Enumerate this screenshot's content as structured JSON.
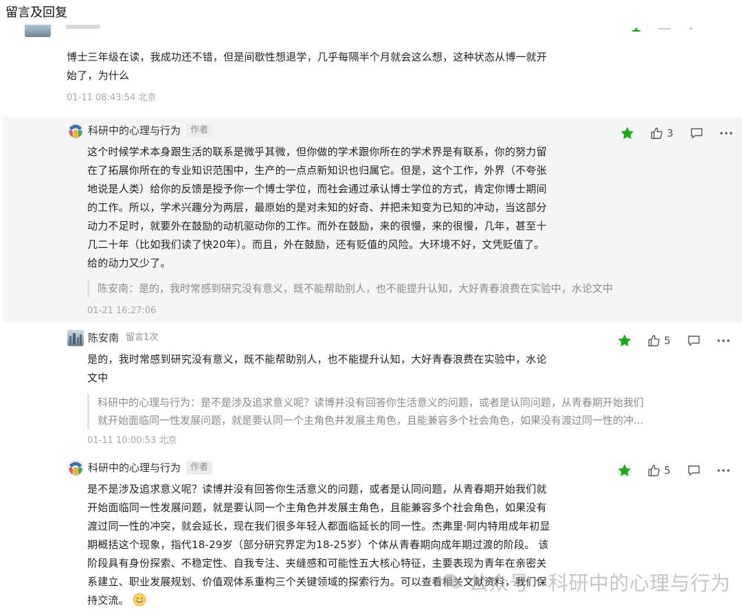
{
  "section_title": "留言及回复",
  "colors": {
    "star_green": "#1aad19",
    "background_highlight": "#f5f5f5",
    "meta_gray": "#a6a6a6",
    "quote_gray": "#8a8a8a"
  },
  "comments": [
    {
      "author": "",
      "content_lines": [
        "博士三年级在读，我成功还不错，但是间歇性想退学，几乎每隔半个月就会这么想，这种状态从博一就开",
        "始了，为什么"
      ],
      "meta": "01-11 08:43:54 北京"
    },
    {
      "author": "科研中的心理与行为",
      "tag": "作者",
      "likes": "3",
      "content_lines": [
        "这个时候学术本身跟生活的联系是微乎其微，但你做的学术跟你所在的学术界是有联系，你的努力留",
        "在了拓展你所在的专业知识范围中，生产的一点点新知识也归属它。但是，这个工作，外界（不夸张",
        "地说是人类）给你的反馈是授予你一个博士学位，而社会通过承认博士学位的方式，肯定你博士期间",
        "的工作。所以，学术兴趣分为两层，最原始的是对未知的好奇、并把未知变为已知的冲动，当这部分",
        "动力不足时，就要外在鼓励的动机驱动你的工作。而外在鼓励，来的很慢，来的很慢，几年，甚至十",
        "几二十年（比如我们读了快20年）。而且，外在鼓励，还有贬值的风险。大环境不好，文凭贬值了。",
        "给的动力又少了。"
      ],
      "quote_lines": [
        "陈安南：是的，我时常感到研究没有意义，既不能帮助别人，也不能提升认知，大好青春浪费在实验中，水论文中"
      ],
      "meta": "01-21 16:27:06"
    },
    {
      "author": "陈安南",
      "tag": "留言1次",
      "likes": "5",
      "content_lines": [
        "是的，我时常感到研究没有意义，既不能帮助别人，也不能提升认知，大好青春浪费在实验中，水论",
        "文中"
      ],
      "quote_lines": [
        "科研中的心理与行为：是不是涉及追求意义呢？读博并没有回答你生活意义的问题，或者是认同问题，从青春期开始我们",
        "就开始面临同一性发展问题，就是要认同一个主角色并发展主角色，且能兼容多个社会角色，如果没有渡过同一性的冲..."
      ],
      "meta": "01-11 10:00:53 北京"
    },
    {
      "author": "科研中的心理与行为",
      "tag": "作者",
      "likes": "5",
      "content_lines": [
        "是不是涉及追求意义呢？读博并没有回答你生活意义的问题，或者是认同问题，从青春期开始我们就",
        "开始面临同一性发展问题，就是要认同一个主角色并发展主角色，且能兼容多个社会角色，如果没有",
        "渡过同一性的冲突，就会延长，现在我们很多年轻人都面临延长的同一性。杰弗里·阿内特用成年初显",
        "期概括这个现象，指代18-29岁（部分研究界定为18-25岁）个体从青春期向成年期过渡的阶段。 该",
        "阶段具有身份探索、不稳定性、自我专注、夹缝感和可能性五大核心特征，主要表现为青年在亲密关",
        "系建立、职业发展规划、价值观体系重构三个关键领域的探索行为。可以查看相关文献资料，我们保",
        "持交流。"
      ]
    }
  ],
  "watermark": {
    "prefix": "公众号 ·",
    "name": "科研中的心理与行为"
  }
}
